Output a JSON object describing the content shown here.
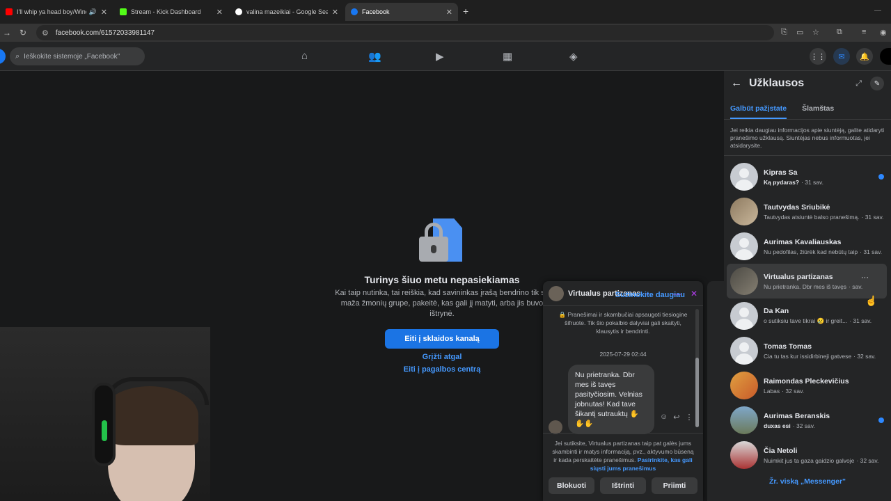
{
  "browser": {
    "tabs": [
      {
        "title": "I'll whip ya head boy/Wind",
        "favicon_color": "#ff0000"
      },
      {
        "title": "Stream - Kick Dashboard",
        "favicon_color": "#53fc18"
      },
      {
        "title": "valina mazeikiai - Google Search",
        "favicon_color": "#ffffff"
      },
      {
        "title": "Facebook",
        "favicon_color": "#1877f2"
      }
    ],
    "url": "facebook.com/61572033981147"
  },
  "facebook": {
    "search_placeholder": "Ieškokite sistemoje „Facebook\""
  },
  "content_unavailable": {
    "title": "Turinys šiuo metu nepasiekiamas",
    "description": "Kai taip nutinka, tai reiškia, kad savininkas įrašą bendrino tik su maža žmonių grupe, pakeitė, kas gali jį matyti, arba jis buvo ištrynė.",
    "button": "Eiti į sklaidos kanalą",
    "link_back": "Grįžti atgal",
    "link_help": "Eiti į pagalbos centrą"
  },
  "chat_window": {
    "name": "Virtualus partizanas",
    "encryption_note": "Pranešimai ir skambučiai apsaugoti tiesiogine šifruote. Tik šio pokalbio dalyviai gali skaityti, klausytis ir bendrinti.",
    "learn_more": "Sužinokite daugiau",
    "date": "2025-07-29 02:44",
    "message": "Nu prietranka. Dbr mes iš tavęs pasityčiosim. Velnias jobnutas! Kad tave šikantį sutrauktų ✋✋✋",
    "consent_text": "Jei sutiksite, Virtualus partizanas taip pat galės jums skambinti ir matys informaciją, pvz., aktyvumo būseną ir kada perskaitėte pranešimus.",
    "consent_link": "Pasirinkite, kas gali siųsti jums pranešimus",
    "buttons": {
      "block": "Blokuoti",
      "delete": "Ištrinti",
      "accept": "Priimti"
    }
  },
  "requests_panel": {
    "title": "Užklausos",
    "tabs": {
      "maybe_know": "Galbūt pažįstate",
      "spam": "Šlamštas"
    },
    "info": "Jei reikia daugiau informacijos apie siuntėją, galite atidaryti pranešimo užklausą. Siuntėjas nebus informuotas, jei atsidarysite.",
    "conversations": [
      {
        "name": "Kipras Sa",
        "preview": "Ką pydaras?",
        "time": "· 31 sav.",
        "unread": true
      },
      {
        "name": "Tautvydas Sriubikė",
        "preview": "Tautvydas atsiuntė balso pranešimą.",
        "time": "· 31 sav.",
        "unread": false
      },
      {
        "name": "Aurimas Kavaliauskas",
        "preview": "Nu pedofilas, žiūrėk kad nebūtų taip",
        "time": "· 31 sav.",
        "unread": false
      },
      {
        "name": "Virtualus partizanas",
        "preview": "Nu prietranka. Dbr mes iš tavęs",
        "time": "· sav.",
        "unread": false
      },
      {
        "name": "Da Kan",
        "preview": "o sutiksiu tave tikrai 😢 ir greit...",
        "time": "· 31 sav.",
        "unread": false
      },
      {
        "name": "Tomas Tomas",
        "preview": "Cia tu tas kur issidirbineji gatvese",
        "time": "· 32 sav.",
        "unread": false
      },
      {
        "name": "Raimondas Pleckevičius",
        "preview": "Labas",
        "time": "· 32 sav.",
        "unread": false
      },
      {
        "name": "Aurimas Beranskis",
        "preview": "duxas esi",
        "time": "· 32 sav.",
        "unread": true
      },
      {
        "name": "Čia Netoli",
        "preview": "Nuimkit jus ta gaza gaidzio galvoje",
        "time": "· 32 sav.",
        "unread": false
      }
    ],
    "see_all": "Žr. viską „Messenger\""
  },
  "colors": {
    "accent": "#1b74e4",
    "link": "#4599ff",
    "messenger_purple": "#b43df0"
  }
}
